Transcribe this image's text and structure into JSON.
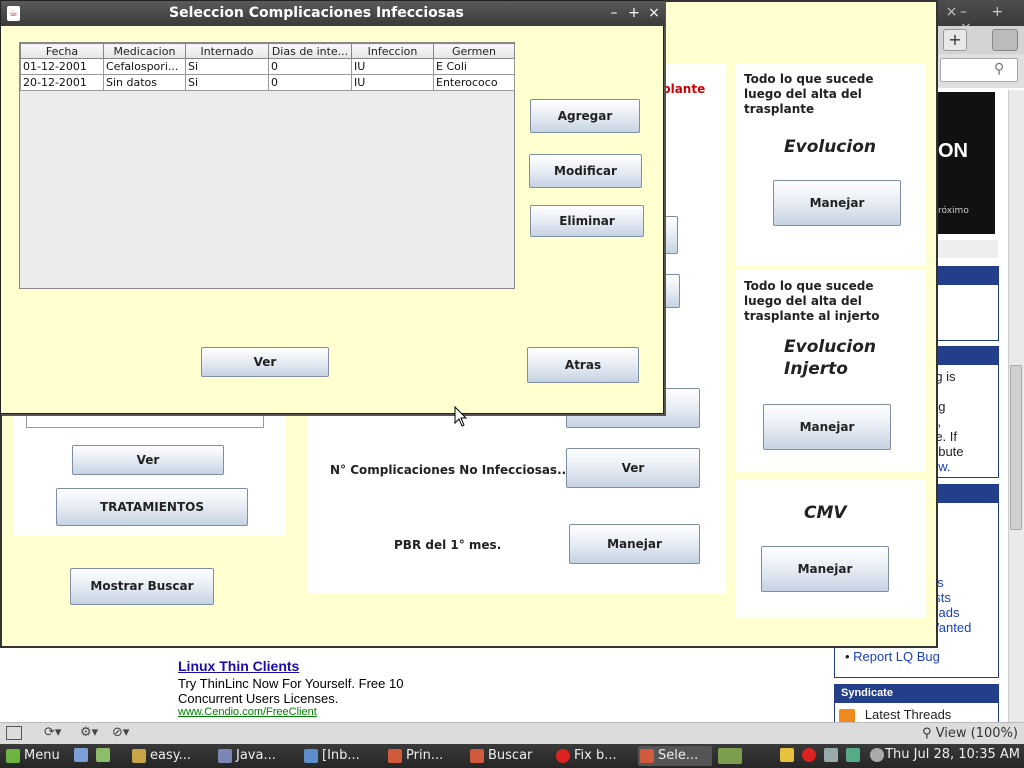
{
  "dialog": {
    "title": "Seleccion Complicaciones Infecciosas",
    "controls": [
      "–",
      "+",
      "×"
    ],
    "table": {
      "headers": [
        "Fecha",
        "Medicacion",
        "Internado",
        "Dias de inte...",
        "Infeccion",
        "Germen"
      ],
      "rows": [
        [
          "01-12-2001",
          "Cefalospori...",
          "Si",
          "0",
          "IU",
          "E Coli"
        ],
        [
          "20-12-2001",
          "Sin datos",
          "Si",
          "0",
          "IU",
          "Enterococo"
        ]
      ]
    },
    "buttons": {
      "agregar": "Agregar",
      "modificar": "Modificar",
      "eliminar": "Eliminar",
      "ver": "Ver",
      "atras": "Atras"
    }
  },
  "main": {
    "partial_red_label": "plante",
    "left": {
      "ver": "Ver",
      "tratamientos": "TRATAMIENTOS",
      "mostrar_buscar": "Mostrar Buscar"
    },
    "center": {
      "no_infecciosas_label": "N° Complicaciones No Infecciosas...",
      "ver": "Ver",
      "pbr_label": "PBR del 1° mes.",
      "manejar": "Manejar"
    },
    "evolucion": {
      "desc": "Todo lo que sucede luego del alta del trasplante",
      "title": "Evolucion",
      "button": "Manejar"
    },
    "evolucion_injerto": {
      "desc": "Todo lo que sucede luego del alta del trasplante al injerto",
      "title": "Evolucion Injerto",
      "button": "Manejar"
    },
    "cmv": {
      "title": "CMV",
      "button": "Manejar"
    }
  },
  "browser": {
    "ad_brand": "ON",
    "ad_next": "róximo",
    "lq_fragments": [
      "rg is",
      "ng",
      "s,",
      "re. If",
      "ribute",
      "ow."
    ],
    "lq_links": [
      "sts",
      "osts",
      "reads",
      "Wanted"
    ],
    "report_bug": "Report LQ Bug",
    "syndicate": "Syndicate",
    "latest_threads": "Latest Threads",
    "ad": {
      "title": "Linux Thin Clients",
      "body": "Try ThinLinc Now For Yourself. Free 10 Concurrent Users Licenses.",
      "url": "www.Cendio.com/FreeClient"
    },
    "zoom": "View (100%)"
  },
  "taskbar": {
    "menu": "Menu",
    "items": [
      "easy...",
      "Java...",
      "[Inb...",
      "Prin...",
      "Buscar",
      "Fix b...",
      "Sele..."
    ],
    "clock": "Thu Jul 28, 10:35 AM"
  }
}
